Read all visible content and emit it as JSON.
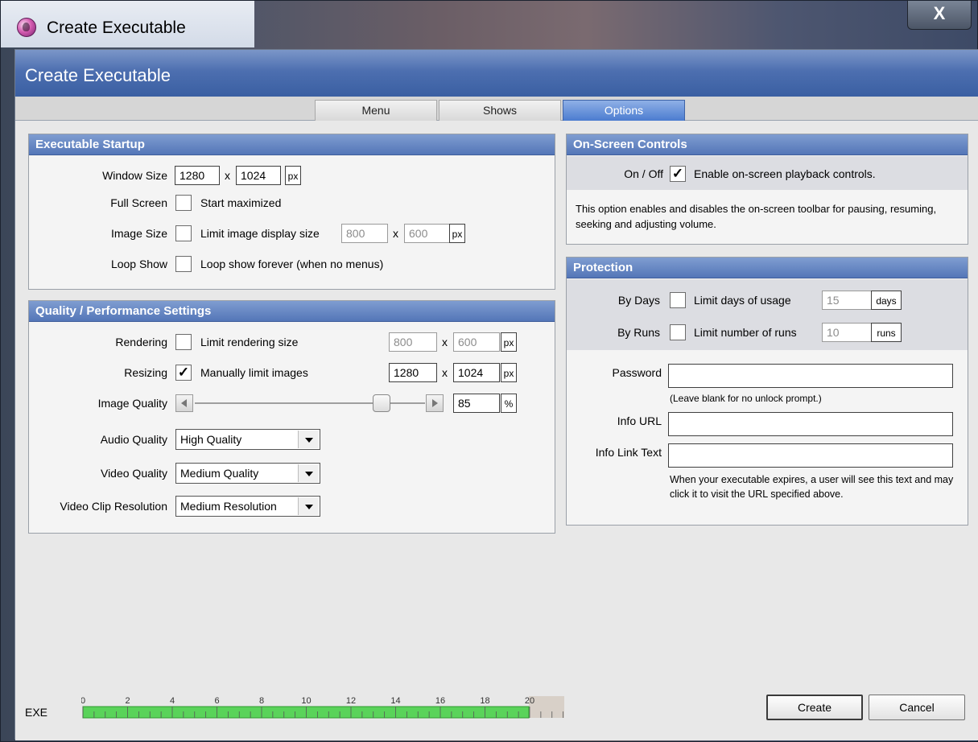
{
  "window": {
    "title": "Create Executable",
    "close_label": "X"
  },
  "banner": {
    "title": "Create Executable"
  },
  "tabs": [
    {
      "label": "Menu",
      "active": false
    },
    {
      "label": "Shows",
      "active": false
    },
    {
      "label": "Options",
      "active": true
    }
  ],
  "startup": {
    "header": "Executable Startup",
    "window_size": {
      "label": "Window Size",
      "width": "1280",
      "sep": "x",
      "height": "1024",
      "unit": "px"
    },
    "full_screen": {
      "label": "Full Screen",
      "checked": false,
      "text": "Start maximized"
    },
    "image_size": {
      "label": "Image Size",
      "checked": false,
      "text": "Limit image display size",
      "width": "800",
      "sep": "x",
      "height": "600",
      "unit": "px"
    },
    "loop_show": {
      "label": "Loop Show",
      "checked": false,
      "text": "Loop show forever (when no menus)"
    }
  },
  "quality": {
    "header": "Quality / Performance Settings",
    "rendering": {
      "label": "Rendering",
      "checked": false,
      "text": "Limit rendering size",
      "width": "800",
      "sep": "x",
      "height": "600",
      "unit": "px"
    },
    "resizing": {
      "label": "Resizing",
      "checked": true,
      "text": "Manually limit images",
      "width": "1280",
      "sep": "x",
      "height": "1024",
      "unit": "px"
    },
    "image_quality": {
      "label": "Image Quality",
      "value": "85",
      "unit": "%",
      "level": 85
    },
    "audio_quality": {
      "label": "Audio Quality",
      "selected": "High Quality"
    },
    "video_quality": {
      "label": "Video Quality",
      "selected": "Medium Quality"
    },
    "video_clip_resolution": {
      "label": "Video Clip Resolution",
      "selected": "Medium Resolution"
    }
  },
  "controls": {
    "header": "On-Screen Controls",
    "on_off": {
      "label": "On / Off",
      "checked": true,
      "text": "Enable on-screen playback controls."
    },
    "description": "This option enables and disables the on-screen toolbar for pausing, resuming, seeking and adjusting volume."
  },
  "protection": {
    "header": "Protection",
    "by_days": {
      "label": "By Days",
      "checked": false,
      "text": "Limit days of usage",
      "value": "15",
      "unit": "days"
    },
    "by_runs": {
      "label": "By Runs",
      "checked": false,
      "text": "Limit number of runs",
      "value": "10",
      "unit": "runs"
    },
    "password": {
      "label": "Password",
      "value": "",
      "hint": "(Leave blank for no unlock prompt.)"
    },
    "info_url": {
      "label": "Info URL",
      "value": ""
    },
    "info_link_text": {
      "label": "Info Link Text",
      "value": "",
      "hint": "When your executable expires, a user will see this text and may click it to visit the URL specified above."
    }
  },
  "footer": {
    "exe_label": "EXE",
    "ticks": [
      "0",
      "2",
      "4",
      "6",
      "8",
      "10",
      "12",
      "14",
      "16",
      "18",
      "20"
    ],
    "create_label": "Create",
    "cancel_label": "Cancel"
  }
}
